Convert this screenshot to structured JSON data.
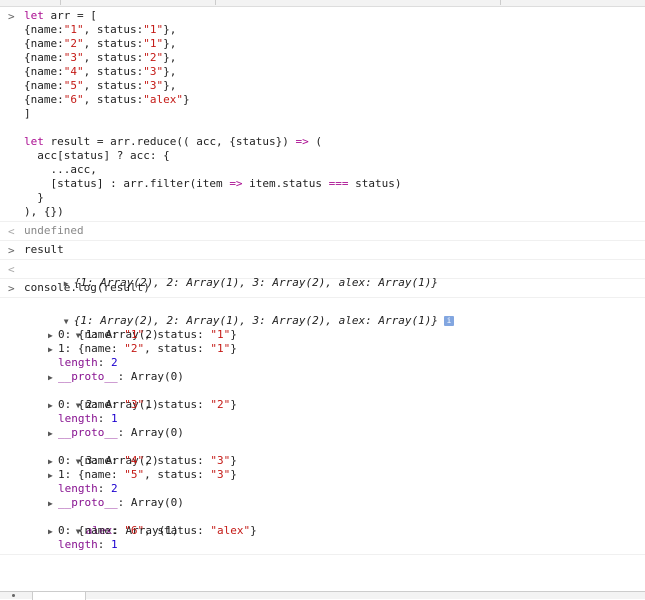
{
  "code_lines": [
    "let arr = [",
    "{name:\"1\", status:\"1\"},",
    "{name:\"2\", status:\"1\"},",
    "{name:\"3\", status:\"2\"},",
    "{name:\"4\", status:\"3\"},",
    "{name:\"5\", status:\"3\"},",
    "{name:\"6\", status:\"alex\"}",
    "]",
    "",
    "let result = arr.reduce(( acc, {status}) => (",
    "  acc[status] ? acc: {",
    "    ...acc,",
    "    [status] : arr.filter(item => item.status === status)",
    "  }",
    "), {})"
  ],
  "undefined_result": "undefined",
  "result_input": "result",
  "result_summary": "{1: Array(2), 2: Array(1), 3: Array(2), alex: Array(1)}",
  "log_input": "console.log(result)",
  "log_summary": "{1: Array(2), 2: Array(1), 3: Array(2), alex: Array(1)}",
  "info_icon": "i",
  "tree": {
    "g1": {
      "key": "1",
      "type": "Array(2)",
      "items": [
        "0: {name: \"1\", status: \"1\"}",
        "1: {name: \"2\", status: \"1\"}"
      ],
      "length_label": "length",
      "length": "2",
      "proto_label": "__proto__",
      "proto": "Array(0)"
    },
    "g2": {
      "key": "2",
      "type": "Array(1)",
      "items": [
        "0: {name: \"3\", status: \"2\"}"
      ],
      "length_label": "length",
      "length": "1",
      "proto_label": "__proto__",
      "proto": "Array(0)"
    },
    "g3": {
      "key": "3",
      "type": "Array(2)",
      "items": [
        "0: {name: \"4\", status: \"3\"}",
        "1: {name: \"5\", status: \"3\"}"
      ],
      "length_label": "length",
      "length": "2",
      "proto_label": "__proto__",
      "proto": "Array(0)"
    },
    "g4": {
      "key": "alex",
      "type": "Array(1)",
      "items": [
        "0: {name: \"6\", status: \"alex\"}"
      ],
      "length_label": "length",
      "length": "1"
    }
  }
}
